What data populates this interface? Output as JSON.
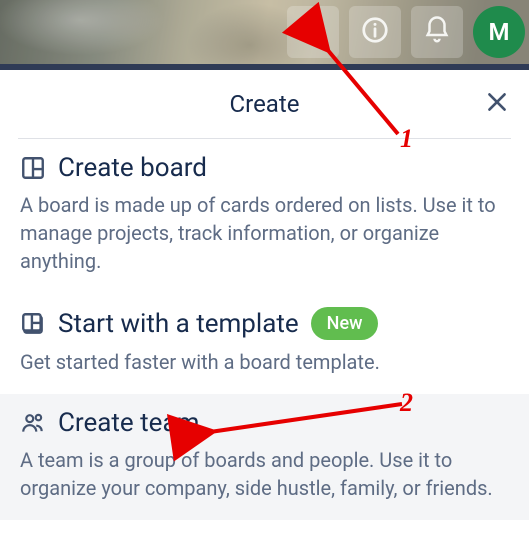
{
  "header": {
    "avatar_initial": "M"
  },
  "popover": {
    "title": "Create",
    "options": {
      "board": {
        "title": "Create board",
        "desc": "A board is made up of cards ordered on lists. Use it to manage projects, track information, or organize anything."
      },
      "template": {
        "title": "Start with a template",
        "badge": "New",
        "desc": "Get started faster with a board template."
      },
      "team": {
        "title": "Create team",
        "desc": "A team is a group of boards and people. Use it to organize your company, side hustle, family, or friends."
      }
    }
  },
  "annotations": {
    "label1": "1",
    "label2": "2"
  }
}
